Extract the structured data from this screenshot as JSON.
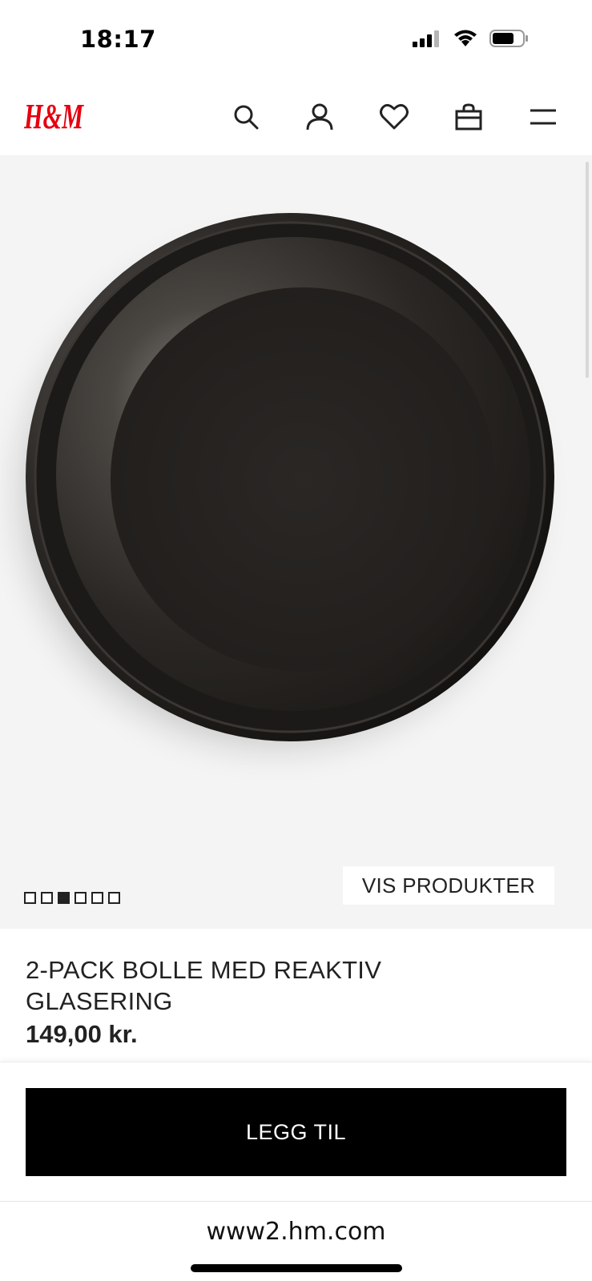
{
  "status_bar": {
    "time": "18:17",
    "icons": [
      "signal-icon",
      "wifi-icon",
      "battery-icon"
    ]
  },
  "header": {
    "logo_text": "H&M",
    "brand_color": "#e50010",
    "icons": [
      "search-icon",
      "account-icon",
      "favorites-icon",
      "bag-icon",
      "menu-icon"
    ]
  },
  "gallery": {
    "image_count": 6,
    "active_index": 2,
    "show_products_label": "VIS PRODUKTER"
  },
  "product": {
    "title_line1": "2-PACK BOLLE MED REAKTIV",
    "title_line2": "GLASERING",
    "price": "149,00 kr."
  },
  "cta": {
    "add_label": "LEGG TIL"
  },
  "browser": {
    "url": "www2.hm.com"
  }
}
